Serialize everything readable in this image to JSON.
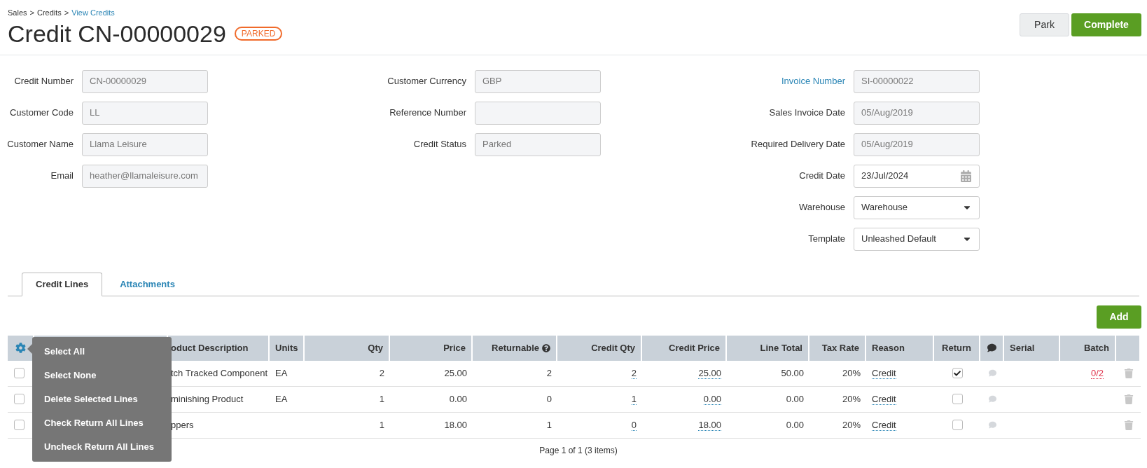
{
  "breadcrumb": {
    "separator": ">",
    "items": [
      {
        "label": "Sales",
        "link": false
      },
      {
        "label": "Credits",
        "link": false
      },
      {
        "label": "View Credits",
        "link": true
      }
    ]
  },
  "title": "Credit CN-00000029",
  "status_badge": "PARKED",
  "actions": [
    {
      "label": "Park",
      "kind": "secondary"
    },
    {
      "label": "Complete",
      "kind": "primary"
    }
  ],
  "form_columns": [
    [
      {
        "label": "Credit Number",
        "value": "CN-00000029",
        "kind": "readonly",
        "label_link": false
      },
      {
        "label": "Customer Code",
        "value": "LL",
        "kind": "readonly",
        "label_link": false
      },
      {
        "label": "Customer Name",
        "value": "Llama Leisure",
        "kind": "readonly",
        "label_link": false
      },
      {
        "label": "Email",
        "value": "heather@llamaleisure.com",
        "kind": "readonly",
        "label_link": false
      }
    ],
    [
      {
        "label": "Customer Currency",
        "value": "GBP",
        "kind": "readonly",
        "label_link": false
      },
      {
        "label": "Reference Number",
        "kind": "readonly",
        "label_link": false
      },
      {
        "label": "Credit Status",
        "value": "Parked",
        "kind": "readonly",
        "label_link": false
      }
    ],
    [
      {
        "label": "Invoice Number",
        "value": "SI-00000022",
        "kind": "readonly",
        "label_link": true
      },
      {
        "label": "Sales Invoice Date",
        "value": "05/Aug/2019",
        "kind": "readonly",
        "label_link": false
      },
      {
        "label": "Required Delivery Date",
        "value": "05/Aug/2019",
        "kind": "readonly",
        "label_link": false
      },
      {
        "label": "Credit Date",
        "value": "23/Jul/2024",
        "kind": "date",
        "label_link": false
      },
      {
        "label": "Warehouse",
        "value": "Warehouse",
        "kind": "select",
        "label_link": false
      },
      {
        "label": "Template",
        "value": "Unleashed Default",
        "kind": "select",
        "label_link": false
      }
    ]
  ],
  "tabs": [
    {
      "label": "Credit Lines",
      "selected": true
    },
    {
      "label": "Attachments",
      "selected": false
    }
  ],
  "add_button": "Add",
  "table": {
    "columns": [
      {
        "kind": "menu"
      },
      {
        "kind": "covered"
      },
      {
        "kind": "text",
        "label": "oduct Description"
      },
      {
        "kind": "text",
        "label": "Units"
      },
      {
        "kind": "number",
        "label": "Qty"
      },
      {
        "kind": "number",
        "label": "Price"
      },
      {
        "kind": "help",
        "label": "Returnable"
      },
      {
        "kind": "entry",
        "label": "Credit Qty"
      },
      {
        "kind": "entry",
        "label": "Credit Price"
      },
      {
        "kind": "number",
        "label": "Line Total"
      },
      {
        "kind": "number",
        "label": "Tax Rate"
      },
      {
        "kind": "choice",
        "label": "Reason"
      },
      {
        "kind": "checkbox",
        "label": "Return"
      },
      {
        "kind": "comment"
      },
      {
        "kind": "text",
        "label": "Serial"
      },
      {
        "kind": "alert",
        "label": "Batch"
      },
      {
        "kind": "trash"
      }
    ],
    "rows": [
      {
        "selected": false,
        "description": "tch Tracked Component",
        "units": "EA",
        "qty": "2",
        "price": "25.00",
        "returnable": "2",
        "credit_qty": "2",
        "credit_price": "25.00",
        "line_total": "50.00",
        "tax_rate": "20%",
        "reason": "Credit",
        "return": true,
        "batch": "0/2"
      },
      {
        "selected": false,
        "description": "minishing Product",
        "units": "EA",
        "qty": "1",
        "price": "0.00",
        "returnable": "0",
        "credit_qty": "1",
        "credit_price": "0.00",
        "line_total": "0.00",
        "tax_rate": "20%",
        "reason": "Credit",
        "return": false
      },
      {
        "selected": false,
        "description": "ppers",
        "qty": "1",
        "price": "18.00",
        "returnable": "1",
        "credit_qty": "0",
        "credit_price": "18.00",
        "line_total": "0.00",
        "tax_rate": "20%",
        "reason": "Credit",
        "return": false
      }
    ]
  },
  "line_menu": {
    "items": [
      "Select All",
      "Select None",
      "Delete Selected Lines",
      "Check Return All Lines",
      "Uncheck Return All Lines"
    ]
  },
  "pagination": "Page 1 of 1 (3 items)"
}
